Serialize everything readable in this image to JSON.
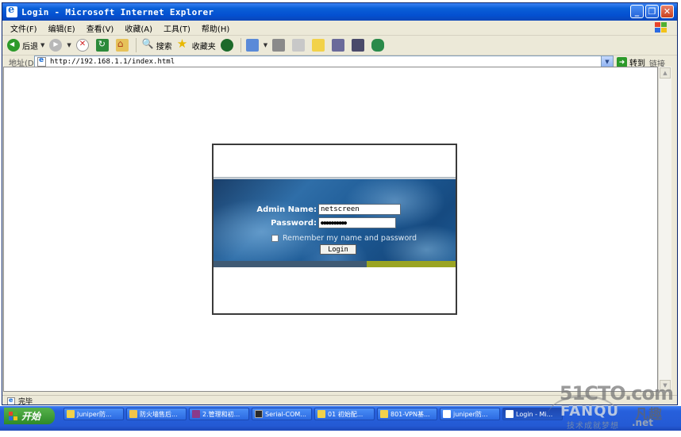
{
  "window": {
    "title": "Login - Microsoft Internet Explorer"
  },
  "menu": [
    "文件(F)",
    "编辑(E)",
    "查看(V)",
    "收藏(A)",
    "工具(T)",
    "帮助(H)"
  ],
  "toolbar": {
    "back": "后退",
    "search": "搜索",
    "favorites": "收藏夹"
  },
  "address": {
    "label": "地址(D)",
    "url": "http://192.168.1.1/index.html",
    "go": "转到",
    "links": "链接"
  },
  "login": {
    "admin_label": "Admin Name:",
    "admin_value": "netscreen",
    "password_label": "Password:",
    "password_value": "●●●●●●●●●●",
    "remember_label": "Remember my name and password",
    "button_label": "Login"
  },
  "status": {
    "text": "完毕"
  },
  "taskbar": {
    "start": "开始",
    "tasks": [
      "Juniper防...",
      "防火墙售后...",
      "2.管理和初...",
      "Serial-COM...",
      "01 初始配...",
      "801-VPN基...",
      "juniper防...",
      "Login - Mi..."
    ]
  },
  "watermark": {
    "site": "51CTO.com",
    "brand": "FANQU",
    "brand_cn": "凡趣",
    "tagline": "技术成就梦想",
    "domain": ".net"
  },
  "colors": {
    "titlebar": "#0450d0",
    "banner": "#1e5b96",
    "stripe_gray": "#3f5a74",
    "stripe_olive": "#9aa422",
    "taskbar": "#245ad4",
    "start": "#2e8a2a"
  }
}
